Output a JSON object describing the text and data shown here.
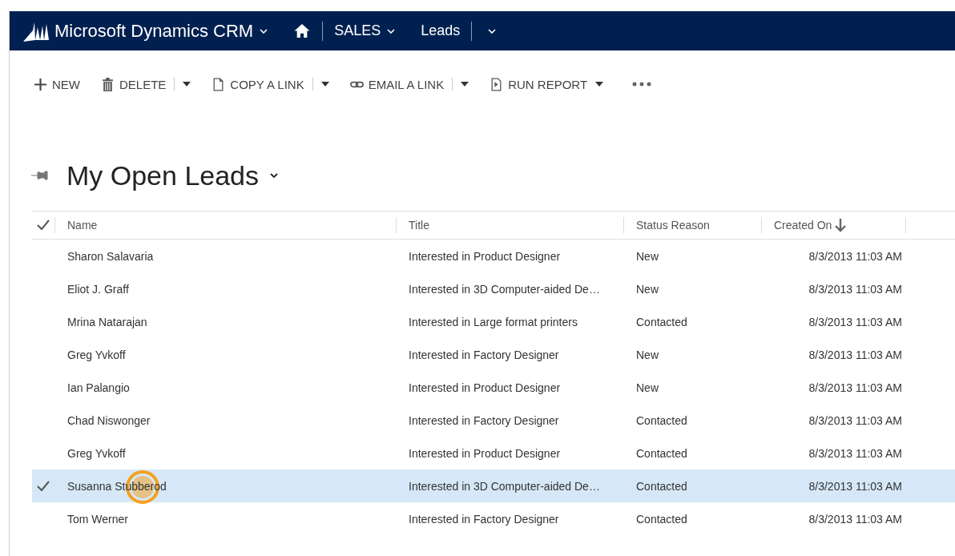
{
  "nav": {
    "product": "Microsoft Dynamics CRM",
    "area": "SALES",
    "entity": "Leads"
  },
  "toolbar": [
    {
      "kind": "new",
      "label": "NEW",
      "split": false,
      "caret": false
    },
    {
      "kind": "delete",
      "label": "DELETE",
      "split": true,
      "caret": true
    },
    {
      "kind": "copy",
      "label": "COPY A LINK",
      "split": true,
      "caret": true
    },
    {
      "kind": "email",
      "label": "EMAIL A LINK",
      "split": true,
      "caret": true
    },
    {
      "kind": "report",
      "label": "RUN REPORT",
      "split": false,
      "caret": true
    }
  ],
  "view": {
    "title": "My Open Leads"
  },
  "table": {
    "columns": [
      {
        "label": "Name",
        "sorted": false
      },
      {
        "label": "Title",
        "sorted": false
      },
      {
        "label": "Status Reason",
        "sorted": false
      },
      {
        "label": "Created On",
        "sorted": true
      }
    ],
    "rows": [
      {
        "name": "Sharon Salavaria",
        "title": "Interested in Product Designer",
        "status": "New",
        "created": "8/3/2013 11:03 AM",
        "selected": false
      },
      {
        "name": "Eliot J. Graff",
        "title": "Interested in 3D Computer-aided De…",
        "status": "New",
        "created": "8/3/2013 11:03 AM",
        "selected": false
      },
      {
        "name": "Mrina Natarajan",
        "title": "Interested in Large format printers",
        "status": "Contacted",
        "created": "8/3/2013 11:03 AM",
        "selected": false
      },
      {
        "name": "Greg Yvkoff",
        "title": "Interested in Factory Designer",
        "status": "New",
        "created": "8/3/2013 11:03 AM",
        "selected": false
      },
      {
        "name": "Ian Palangio",
        "title": "Interested in Product Designer",
        "status": "New",
        "created": "8/3/2013 11:03 AM",
        "selected": false
      },
      {
        "name": "Chad Niswonger",
        "title": "Interested in Factory Designer",
        "status": "Contacted",
        "created": "8/3/2013 11:03 AM",
        "selected": false
      },
      {
        "name": "Greg Yvkoff",
        "title": "Interested in Product Designer",
        "status": "Contacted",
        "created": "8/3/2013 11:03 AM",
        "selected": false
      },
      {
        "name": "Susanna Stubberod",
        "title": "Interested in 3D Computer-aided De…",
        "status": "Contacted",
        "created": "8/3/2013 11:03 AM",
        "selected": true,
        "clicked": true
      },
      {
        "name": "Tom Werner",
        "title": "Interested in Factory Designer",
        "status": "Contacted",
        "created": "8/3/2013 11:03 AM",
        "selected": false
      }
    ]
  }
}
